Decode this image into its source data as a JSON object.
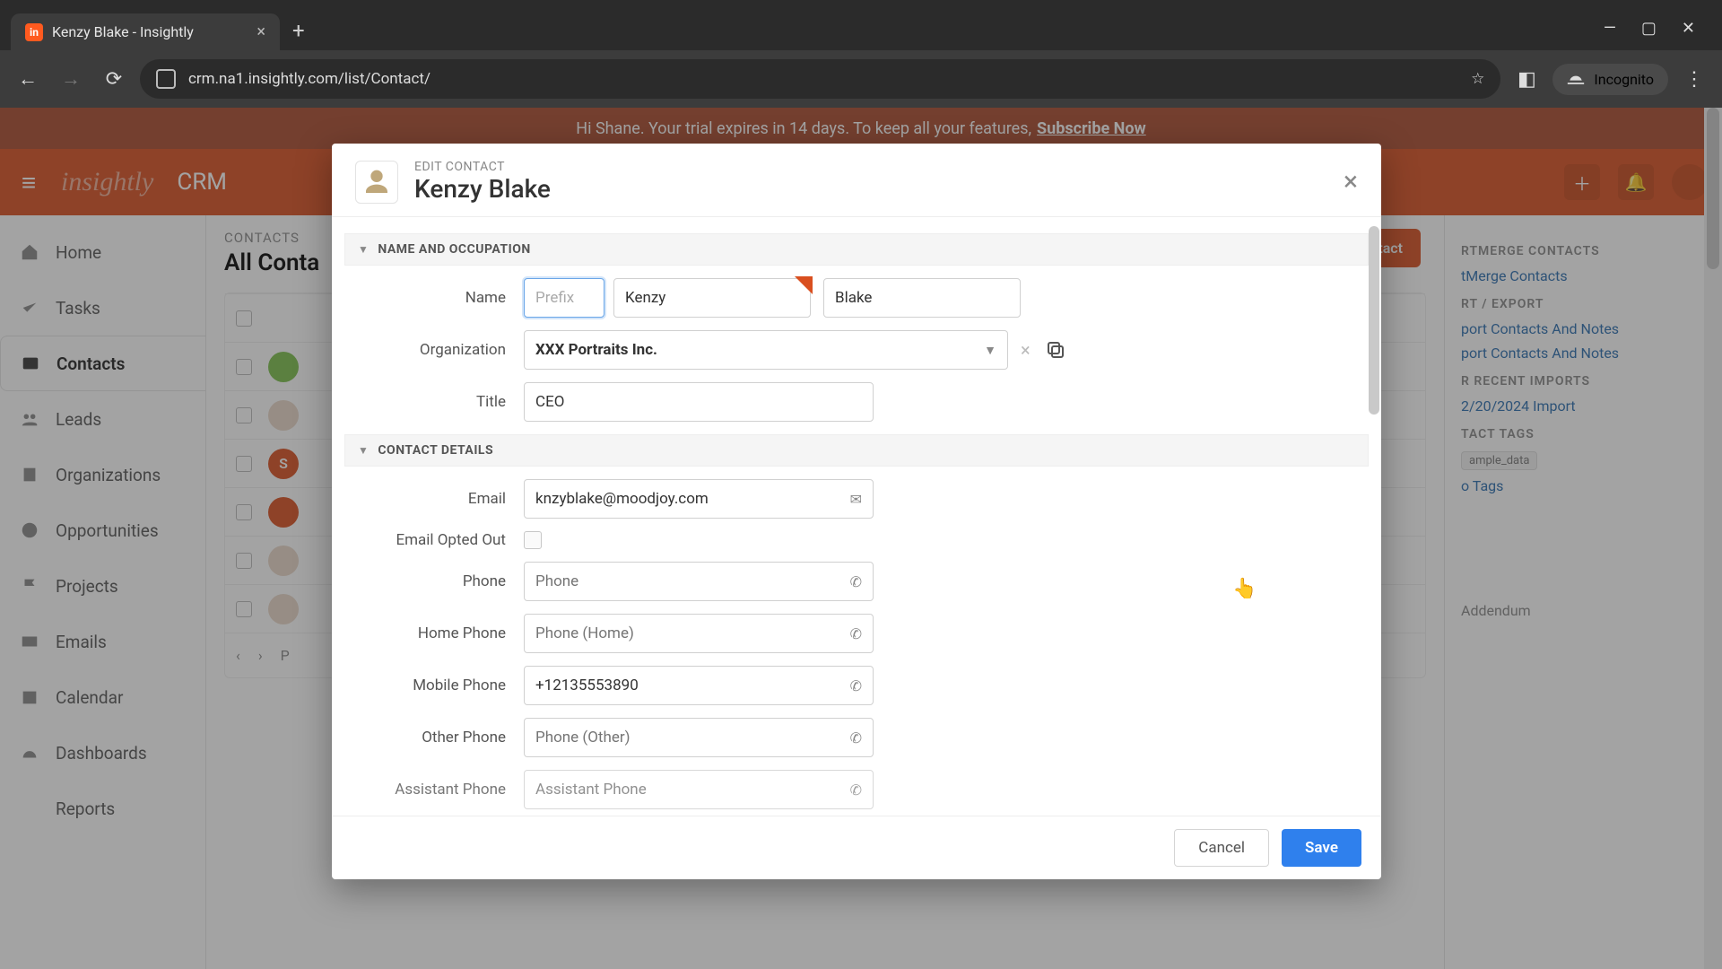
{
  "browser": {
    "tab_title": "Kenzy Blake - Insightly",
    "url": "crm.na1.insightly.com/list/Contact/",
    "incognito_label": "Incognito"
  },
  "trial_bar": {
    "message_prefix": "Hi Shane. Your trial expires in 14 days. To keep all your features, ",
    "cta": "Subscribe Now"
  },
  "app_header": {
    "logo_text": "insightly",
    "product": "CRM"
  },
  "left_nav": [
    {
      "label": "Home",
      "icon": "home"
    },
    {
      "label": "Tasks",
      "icon": "check"
    },
    {
      "label": "Contacts",
      "icon": "id"
    },
    {
      "label": "Leads",
      "icon": "leads"
    },
    {
      "label": "Organizations",
      "icon": "org"
    },
    {
      "label": "Opportunities",
      "icon": "target"
    },
    {
      "label": "Projects",
      "icon": "flag"
    },
    {
      "label": "Emails",
      "icon": "mail"
    },
    {
      "label": "Calendar",
      "icon": "cal"
    },
    {
      "label": "Dashboards",
      "icon": "dash"
    },
    {
      "label": "Reports",
      "icon": "bars"
    }
  ],
  "main": {
    "label": "CONTACTS",
    "title": "All Conta",
    "rows": [
      {
        "avatar_letter": "",
        "avatar_bg": "#7cc04b"
      },
      {
        "avatar_letter": "",
        "avatar_bg": "#e9d7c8"
      },
      {
        "avatar_letter": "S",
        "avatar_bg": "#d94f1f"
      },
      {
        "avatar_letter": "",
        "avatar_bg": "#d94f1f"
      },
      {
        "avatar_letter": "",
        "avatar_bg": "#e9d7c8"
      },
      {
        "avatar_letter": "",
        "avatar_bg": "#e9d7c8"
      }
    ],
    "pager_letter": "P",
    "new_contact": "New Contact"
  },
  "right": {
    "h1": "RTMERGE CONTACTS",
    "l1": "tMerge Contacts",
    "h2": "RT / EXPORT",
    "l2a": "port Contacts And Notes",
    "l2b": "port Contacts And Notes",
    "h3": "R RECENT IMPORTS",
    "l3": "2/20/2024 Import",
    "h4": "TACT TAGS",
    "tag": "ample_data",
    "l4": "o Tags",
    "addendum": "Addendum"
  },
  "modal": {
    "subtitle": "EDIT CONTACT",
    "title": "Kenzy Blake",
    "section_name": "NAME AND OCCUPATION",
    "section_details": "CONTACT DETAILS",
    "labels": {
      "name": "Name",
      "organization": "Organization",
      "title": "Title",
      "email": "Email",
      "opted_out": "Email Opted Out",
      "phone": "Phone",
      "home_phone": "Home Phone",
      "mobile_phone": "Mobile Phone",
      "other_phone": "Other Phone",
      "assistant_phone": "Assistant Phone"
    },
    "placeholders": {
      "prefix": "Prefix",
      "phone": "Phone",
      "home_phone": "Phone (Home)",
      "other_phone": "Phone (Other)",
      "assistant_phone": "Assistant Phone"
    },
    "values": {
      "first_name": "Kenzy",
      "last_name": "Blake",
      "organization": "XXX Portraits Inc.",
      "title": "CEO",
      "email": "knzyblake@moodjoy.com",
      "mobile_phone": "+12135553890"
    },
    "buttons": {
      "cancel": "Cancel",
      "save": "Save"
    }
  }
}
